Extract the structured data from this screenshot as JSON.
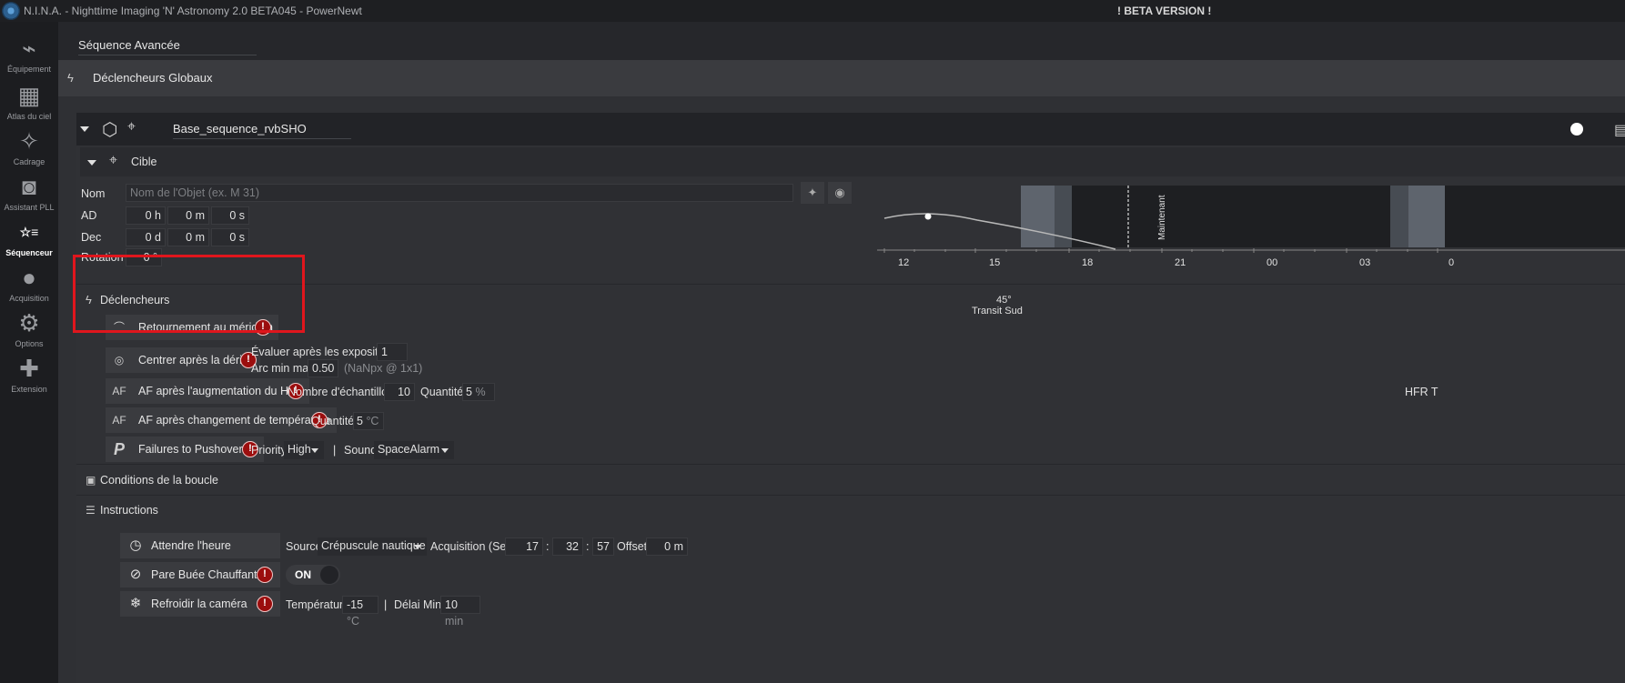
{
  "window": {
    "title": "N.I.N.A. - Nighttime Imaging 'N' Astronomy 2.0 BETA045  -  PowerNewt",
    "beta_banner": "! BETA VERSION !"
  },
  "sidebar": {
    "items": [
      {
        "label": "Équipement",
        "icon": "equipment-icon"
      },
      {
        "label": "Atlas du ciel",
        "icon": "sky-atlas-icon"
      },
      {
        "label": "Cadrage",
        "icon": "framing-icon"
      },
      {
        "label": "Assistant PLL",
        "icon": "polar-alignment-icon"
      },
      {
        "label": "Séquenceur",
        "icon": "sequencer-icon",
        "active": true
      },
      {
        "label": "Acquisition",
        "icon": "imaging-icon"
      },
      {
        "label": "Options",
        "icon": "gears-icon"
      },
      {
        "label": "Extension",
        "icon": "puzzle-icon"
      }
    ]
  },
  "header": {
    "title": "Séquence Avancée",
    "global_triggers": "Déclencheurs Globaux"
  },
  "sequence": {
    "name": "Base_sequence_rvbSHO"
  },
  "target": {
    "section": "Cible",
    "nom_label": "Nom",
    "nom_placeholder": "Nom de l'Objet (ex. M 31)",
    "ad_label": "AD",
    "ad_h": "0 h",
    "ad_m": "0 m",
    "ad_s": "0 s",
    "dec_label": "Dec",
    "dec_d": "0 d",
    "dec_m": "0 m",
    "dec_s": "0 s",
    "rotation_label": "Rotation",
    "rotation": "0 °"
  },
  "altitude_chart": {
    "altitude_label": "45°",
    "transit_label": "Transit Sud",
    "now_label": "Maintenant",
    "x_ticks": [
      "12",
      "15",
      "18",
      "21",
      "00",
      "03",
      "0"
    ]
  },
  "triggers": {
    "section": "Déclencheurs",
    "meridian_flip": "Retournement au méridien",
    "center": {
      "name": "Centrer après la dérive",
      "eval_label": "Évaluer après les expositions",
      "eval_value": "1",
      "arc_label": "Arc min max",
      "arc_value": "0.50",
      "arc_hint": "(NaNpx @ 1x1)"
    },
    "af_hfr": {
      "name": "AF après l'augmentation du HFR",
      "samples_label": "Nombre d'échantillon",
      "samples_value": "10",
      "qty_label": "Quantité",
      "qty_value": "5",
      "qty_unit": "%",
      "right_label": "HFR T"
    },
    "af_temp": {
      "name": "AF après changement de température",
      "qty_label": "Quantité",
      "qty_value": "5",
      "qty_unit": "°C"
    },
    "pushover": {
      "name": "Failures to Pushover",
      "priority_label": "Priority",
      "priority_value": "High",
      "sep": "|",
      "sound_label": "Sound",
      "sound_value": "SpaceAlarm"
    }
  },
  "loop_conditions": "Conditions de la boucle",
  "instructions": {
    "section": "Instructions",
    "wait_time": {
      "name": "Attendre l'heure",
      "source_label": "Source",
      "source_value": "Crépuscule nautique",
      "acq_label": "Acquisition (Sec)",
      "h": "17",
      "colon1": ":",
      "m": "32",
      "colon2": ":",
      "s": "57",
      "offset_label": "Offset",
      "offset_value": "0 m"
    },
    "dew_heater": {
      "name": "Pare Buée Chauffant",
      "toggle": "ON"
    },
    "cool_camera": {
      "name": "Refroidir la caméra",
      "temp_label": "Température",
      "temp_value": "-15",
      "temp_unit": "°C",
      "sep": "|",
      "delay_label": "Délai Min.",
      "delay_value": "10",
      "delay_unit": "min"
    }
  },
  "colors": {
    "warning": "#9b0e0e",
    "highlight": "#e0161d",
    "background": "#2f3034"
  }
}
